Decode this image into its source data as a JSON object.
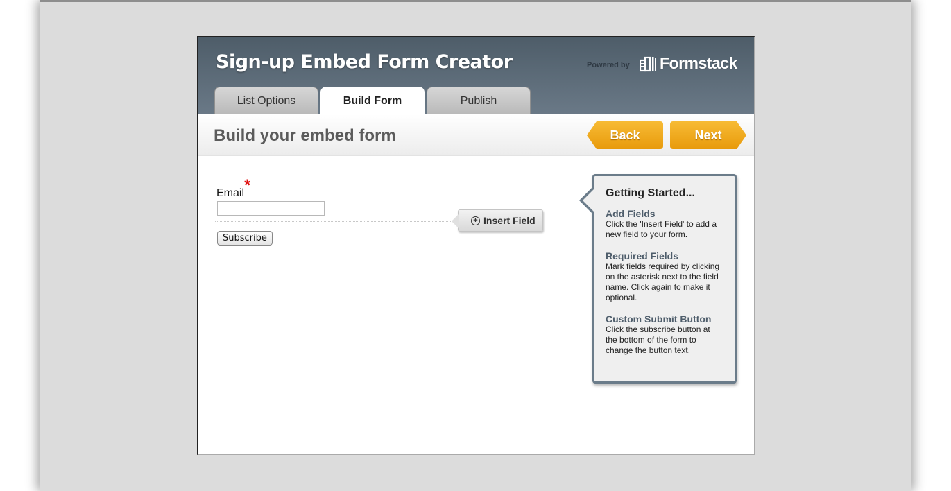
{
  "header": {
    "title": "Sign-up Embed Form Creator",
    "powered_by": "Powered by",
    "brand": "Formstack"
  },
  "tabs": [
    {
      "label": "List Options",
      "active": false
    },
    {
      "label": "Build Form",
      "active": true
    },
    {
      "label": "Publish",
      "active": false
    }
  ],
  "subheader": {
    "title": "Build your embed form",
    "back_label": "Back",
    "next_label": "Next"
  },
  "form": {
    "field_label": "Email",
    "required_marker": "*",
    "email_value": "",
    "insert_field_label": "Insert Field",
    "submit_label": "Subscribe"
  },
  "help": {
    "title": "Getting Started...",
    "sections": [
      {
        "heading": "Add Fields",
        "text": "Click the 'Insert Field' to add a new field to your form."
      },
      {
        "heading": "Required Fields",
        "text": "Mark fields required by clicking on the asterisk next to the field name. Click again to make it optional."
      },
      {
        "heading": "Custom Submit Button",
        "text": "Click the subscribe button at the bottom of the form to change the button text."
      }
    ]
  },
  "colors": {
    "header_dark": "#4e5d69",
    "accent_orange": "#f0a51c",
    "required_red": "#e01010",
    "help_border": "#6b7c8a"
  },
  "icons": {
    "brand_logo": "formstack-logo-icon",
    "insert": "plus-circle-icon"
  }
}
